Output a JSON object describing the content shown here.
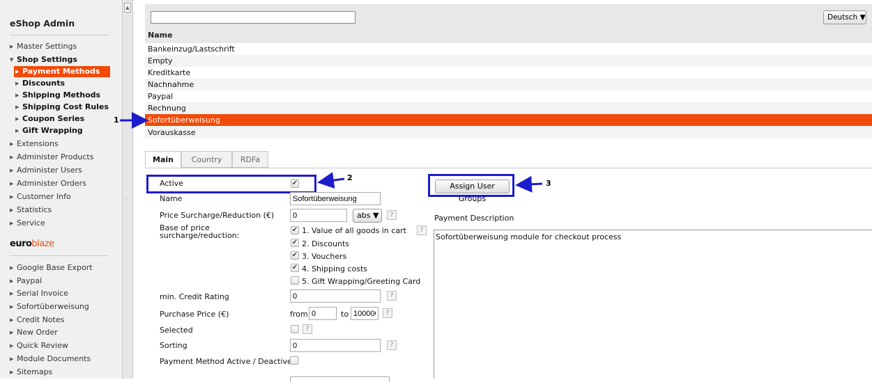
{
  "sidebar": {
    "title": "eShop Admin",
    "items_top": [
      {
        "label": "Master Settings"
      },
      {
        "label": "Shop Settings"
      }
    ],
    "sub_items": [
      {
        "label": "Payment Methods"
      },
      {
        "label": "Discounts"
      },
      {
        "label": "Shipping Methods"
      },
      {
        "label": "Shipping Cost Rules"
      },
      {
        "label": "Coupon Series"
      },
      {
        "label": "Gift Wrapping"
      }
    ],
    "items_mid": [
      {
        "label": "Extensions"
      },
      {
        "label": "Administer Products"
      },
      {
        "label": "Administer Users"
      },
      {
        "label": "Administer Orders"
      },
      {
        "label": "Customer Info"
      },
      {
        "label": "Statistics"
      },
      {
        "label": "Service"
      }
    ],
    "logo": {
      "part1": "euro",
      "part2": "blaze"
    },
    "items_bottom": [
      {
        "label": "Google Base Export"
      },
      {
        "label": "Paypal"
      },
      {
        "label": "Serial Invoice"
      },
      {
        "label": "Sofortüberweisung"
      },
      {
        "label": "Credit Notes"
      },
      {
        "label": "New Order"
      },
      {
        "label": "Quick Review"
      },
      {
        "label": "Module Documents"
      },
      {
        "label": "Sitemaps"
      }
    ]
  },
  "list": {
    "search_value": "",
    "language": "Deutsch",
    "column_header": "Name",
    "rows": [
      "Bankeinzug/Lastschrift",
      "Empty",
      "Kreditkarte",
      "Nachnahme",
      "Paypal",
      "Rechnung",
      "Sofortüberweisung",
      "Vorauskasse"
    ],
    "selected_row": "Sofortüberweisung"
  },
  "tabs": [
    "Main",
    "Country",
    "RDFa"
  ],
  "form": {
    "active_label": "Active",
    "active_checked": true,
    "name_label": "Name",
    "name_value": "Sofortüberweisung",
    "surcharge_label": "Price Surcharge/Reduction (€)",
    "surcharge_value": "0",
    "surcharge_unit": "abs",
    "base_label_1": "Base of price",
    "base_label_2": "surcharge/reduction:",
    "base_options": [
      {
        "label": "1. Value of all goods in cart",
        "checked": true
      },
      {
        "label": "2. Discounts",
        "checked": true
      },
      {
        "label": "3. Vouchers",
        "checked": true
      },
      {
        "label": "4. Shipping costs",
        "checked": true
      },
      {
        "label": "5. Gift Wrapping/Greeting Card",
        "checked": false
      }
    ],
    "credit_label": "min. Credit Rating",
    "credit_value": "0",
    "purchase_label": "Purchase Price (€)",
    "from_label": "from",
    "from_value": "0",
    "to_label": "to",
    "to_value": "100000",
    "selected_label": "Selected",
    "selected_checked": false,
    "sorting_label": "Sorting",
    "sorting_value": "0",
    "toggle_label": "Payment Method Active / Deactive",
    "toggle_checked": false,
    "assign_button": "Assign User Groups",
    "description_label": "Payment Description",
    "description_value": "Sofortüberweisung module for checkout process"
  },
  "annotations": [
    "1",
    "2",
    "3"
  ],
  "help_glyph": "?",
  "colors": {
    "accent": "#f24a08",
    "highlight_box": "#1d1ccc"
  }
}
